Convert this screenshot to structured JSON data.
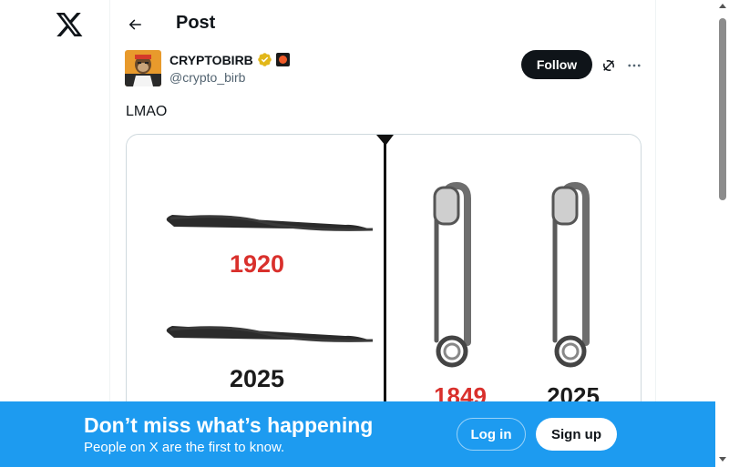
{
  "nav": {
    "logo_icon": "x-logo-icon"
  },
  "header": {
    "back_icon": "arrow-left-icon",
    "title": "Post"
  },
  "post": {
    "author": {
      "name": "CRYPTOBIRB",
      "handle": "@crypto_birb",
      "verified_badge": "gold-verified-icon",
      "affiliate_badge": "affiliation-icon"
    },
    "follow_label": "Follow",
    "text": "LMAO",
    "media": {
      "left_panel": {
        "top_year": "1920",
        "bottom_year": "2025"
      },
      "right_panel": {
        "left_year": "1849",
        "right_year": "2025"
      }
    }
  },
  "banner": {
    "title": "Don’t miss what’s happening",
    "subtitle": "People on X are the first to know.",
    "login_label": "Log in",
    "signup_label": "Sign up"
  },
  "colors": {
    "accent": "#1d9bf0",
    "text": "#0f1419",
    "muted": "#536471",
    "year_red": "#d9302c"
  }
}
